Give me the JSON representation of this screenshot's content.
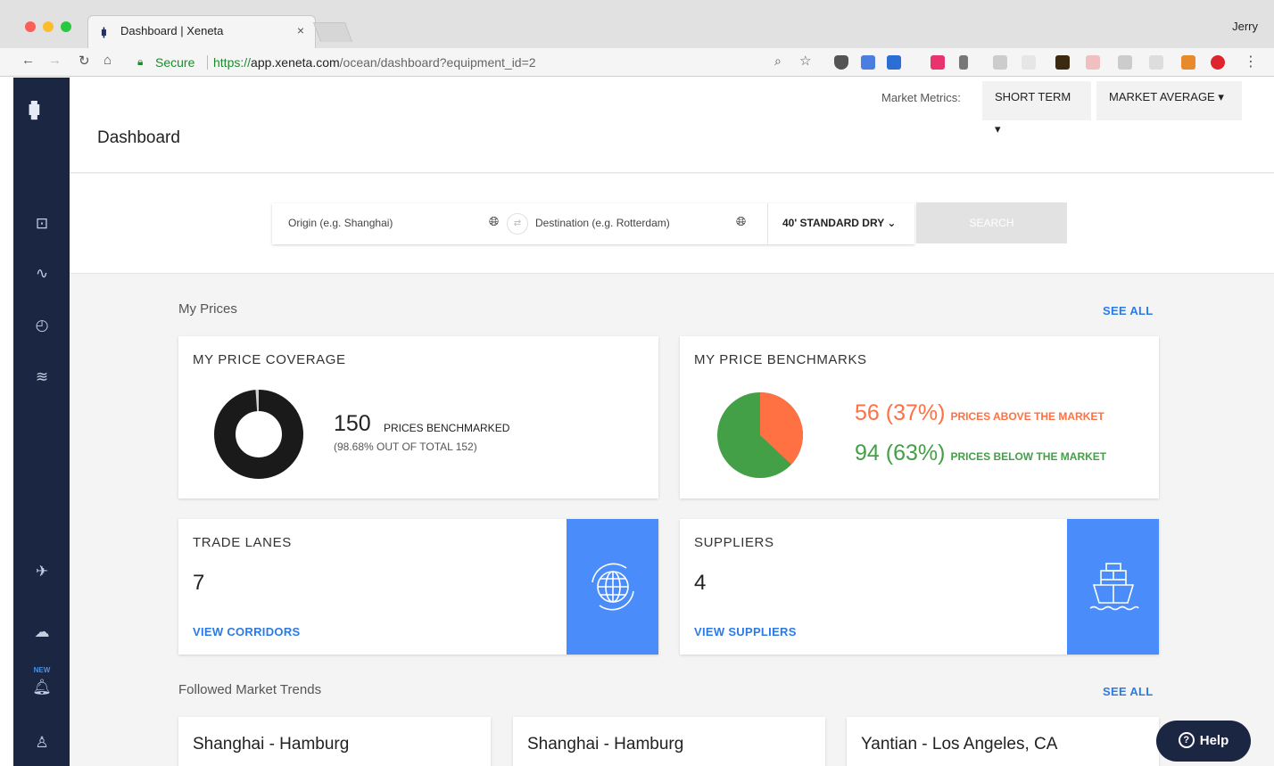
{
  "browser": {
    "tab_title": "Dashboard | Xeneta",
    "tab_close": "×",
    "profile": "Jerry",
    "secure_label": "Secure",
    "url_scheme": "https://",
    "url_host": "app.xeneta.com",
    "url_path": "/ocean/dashboard?equipment_id=2"
  },
  "header": {
    "title": "Dashboard",
    "market_metrics_label": "Market Metrics:",
    "short_term": "SHORT TERM ▾",
    "market_average": "MARKET AVERAGE ▾"
  },
  "search": {
    "origin_placeholder": "Origin (e.g. Shanghai)",
    "destination_placeholder": "Destination (e.g. Rotterdam)",
    "equipment": "40' STANDARD DRY ⌄",
    "button": "SEARCH"
  },
  "my_prices": {
    "title": "My Prices",
    "see_all": "SEE ALL",
    "coverage": {
      "title": "MY PRICE COVERAGE",
      "count": "150",
      "count_label": "PRICES BENCHMARKED",
      "subtitle": "(98.68% OUT OF TOTAL 152)",
      "fraction": 0.9868
    },
    "benchmarks": {
      "title": "MY PRICE BENCHMARKS",
      "above_value": "56 (37%)",
      "above_label": "PRICES ABOVE THE MARKET",
      "below_value": "94 (63%)",
      "below_label": "PRICES BELOW THE MARKET",
      "above_fraction": 0.37,
      "colors": {
        "above": "#ff7043",
        "below": "#43a047"
      }
    }
  },
  "trade_lanes": {
    "title": "TRADE LANES",
    "count": "7",
    "link": "VIEW CORRIDORS"
  },
  "suppliers": {
    "title": "SUPPLIERS",
    "count": "4",
    "link": "VIEW SUPPLIERS"
  },
  "trends": {
    "title": "Followed Market Trends",
    "see_all": "SEE ALL",
    "routes": [
      "Shanghai - Hamburg",
      "Shanghai - Hamburg",
      "Yantian - Los Angeles, CA"
    ]
  },
  "help": {
    "label": "Help"
  },
  "colors": {
    "sidebar": "#1b2642",
    "accent": "#2c7be5",
    "tile": "#4a8dfa"
  }
}
